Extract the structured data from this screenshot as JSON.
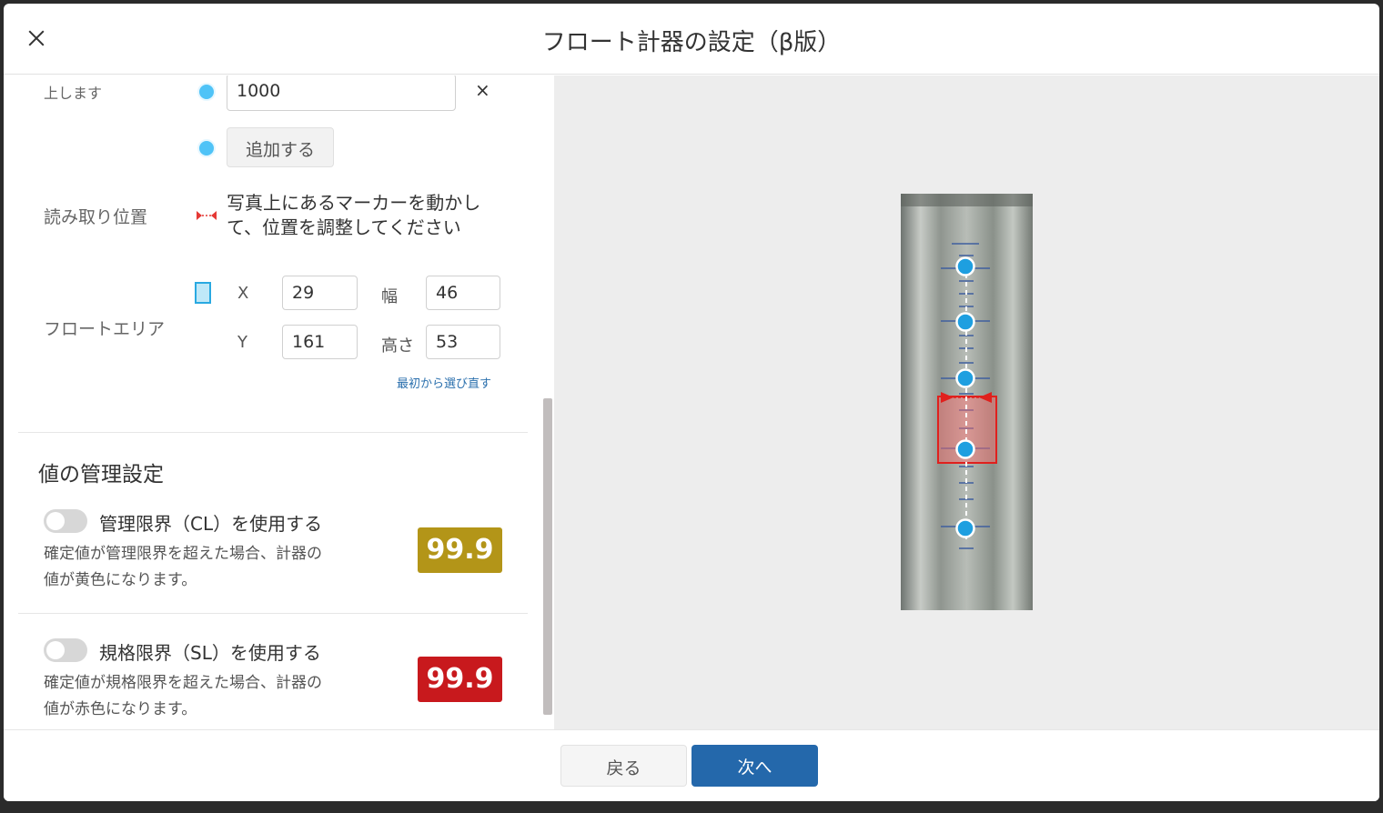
{
  "header": {
    "title": "フロート計器の設定（β版）"
  },
  "left": {
    "partial_label": "上します",
    "marker_value": "1000",
    "remove_glyph": "×",
    "add_button": "追加する",
    "read_position": {
      "label": "読み取り位置",
      "instruction_line1": "写真上にあるマーカーを動かし",
      "instruction_line2": "て、位置を調整してください"
    },
    "float_area": {
      "label": "フロートエリア",
      "x_label": "X",
      "x_value": "29",
      "width_label": "幅",
      "width_value": "46",
      "y_label": "Y",
      "y_value": "161",
      "height_label": "高さ",
      "height_value": "53",
      "reselect_link": "最初から選び直す"
    },
    "value_management": {
      "title": "値の管理設定",
      "cl": {
        "label": "管理限界（CL）を使用する",
        "desc_line1": "確定値が管理限界を超えた場合、計器の",
        "desc_line2": "値が黄色になります。",
        "sample_value": "99.9",
        "color": "#b39518",
        "enabled": false
      },
      "sl": {
        "label": "規格限界（SL）を使用する",
        "desc_line1": "確定値が規格限界を超えた場合、計器の",
        "desc_line2": "値が赤色になります。",
        "sample_value": "99.9",
        "color": "#c8191d",
        "enabled": false
      }
    }
  },
  "footer": {
    "back": "戻る",
    "next": "次へ"
  },
  "colors": {
    "accent": "#2468ab",
    "marker": "#4fc3f7",
    "float_area": "#e53935"
  }
}
